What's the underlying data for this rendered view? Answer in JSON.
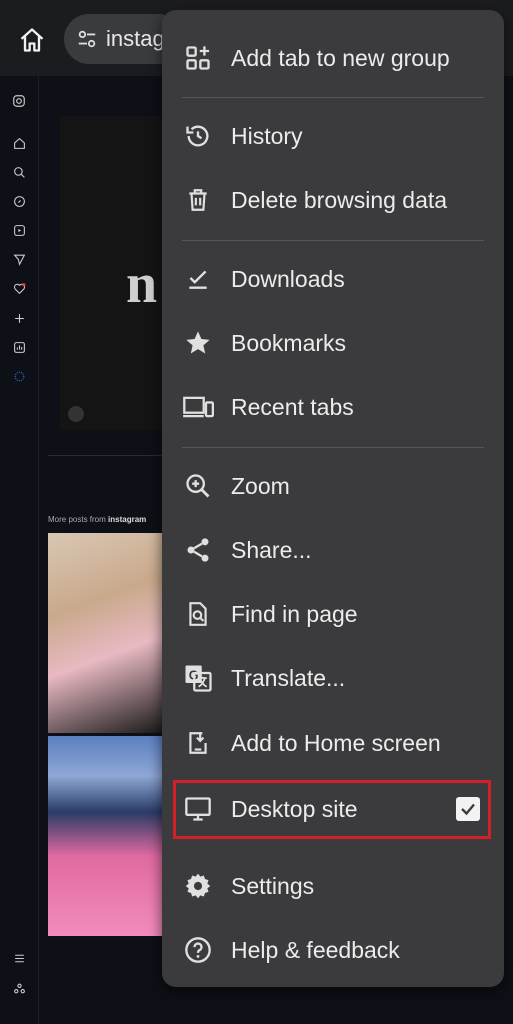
{
  "address_bar": {
    "url": "instagram.com"
  },
  "feed": {
    "logo_partial": "n",
    "more_posts_prefix": "More posts from",
    "more_posts_account": "instagram"
  },
  "menu": {
    "items": [
      {
        "label": "Add tab to new group",
        "icon": "add-to-group-icon"
      },
      {
        "label": "History",
        "icon": "history-icon"
      },
      {
        "label": "Delete browsing data",
        "icon": "trash-icon"
      },
      {
        "label": "Downloads",
        "icon": "download-icon"
      },
      {
        "label": "Bookmarks",
        "icon": "star-icon"
      },
      {
        "label": "Recent tabs",
        "icon": "devices-icon"
      },
      {
        "label": "Zoom",
        "icon": "zoom-icon"
      },
      {
        "label": "Share...",
        "icon": "share-icon"
      },
      {
        "label": "Find in page",
        "icon": "find-icon"
      },
      {
        "label": "Translate...",
        "icon": "translate-icon"
      },
      {
        "label": "Add to Home screen",
        "icon": "add-home-icon"
      },
      {
        "label": "Desktop site",
        "icon": "monitor-icon",
        "checked": true
      },
      {
        "label": "Settings",
        "icon": "gear-icon"
      },
      {
        "label": "Help & feedback",
        "icon": "help-icon"
      }
    ]
  },
  "colors": {
    "menu_bg": "#3b3b3e",
    "highlight": "#d41f26",
    "page_bg": "#0d1016"
  }
}
